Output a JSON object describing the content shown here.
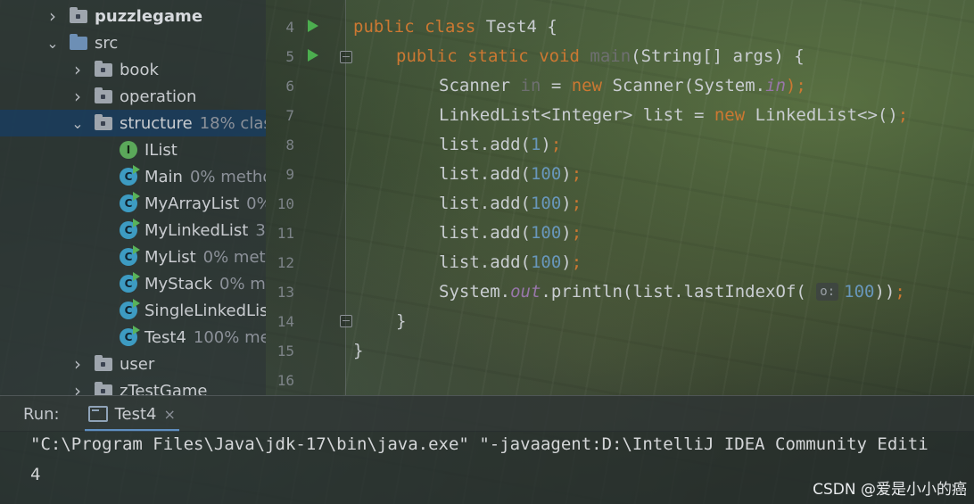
{
  "project_tree": [
    {
      "label": "puzzlegame",
      "coverage": "",
      "icon": "folder-icon",
      "expanded": false,
      "bold": true
    },
    {
      "label": "src",
      "coverage": "",
      "icon": "source-folder-icon",
      "expanded": true,
      "bold": false
    },
    {
      "label": "book",
      "coverage": "",
      "icon": "package-icon",
      "expanded": false
    },
    {
      "label": "operation",
      "coverage": "",
      "icon": "package-icon",
      "expanded": false
    },
    {
      "label": "structure",
      "coverage": "18% clas",
      "icon": "package-icon",
      "expanded": true,
      "selected": true
    },
    {
      "label": "IList",
      "coverage": "",
      "icon": "interface-icon"
    },
    {
      "label": "Main",
      "coverage": "0% metho",
      "icon": "class-run-icon"
    },
    {
      "label": "MyArrayList",
      "coverage": "0%",
      "icon": "class-run-icon"
    },
    {
      "label": "MyLinkedList",
      "coverage": "3",
      "icon": "class-run-icon"
    },
    {
      "label": "MyList",
      "coverage": "0% meth",
      "icon": "class-run-icon"
    },
    {
      "label": "MyStack",
      "coverage": "0% m",
      "icon": "class-run-icon"
    },
    {
      "label": "SingleLinkedList",
      "coverage": "",
      "icon": "class-run-icon"
    },
    {
      "label": "Test4",
      "coverage": "100% me",
      "icon": "class-run-icon"
    },
    {
      "label": "user",
      "coverage": "",
      "icon": "package-icon",
      "expanded": false
    },
    {
      "label": "zTestGame",
      "coverage": "",
      "icon": "package-icon",
      "expanded": false
    }
  ],
  "editor": {
    "line_numbers": [
      "4",
      "5",
      "6",
      "7",
      "8",
      "9",
      "10",
      "11",
      "12",
      "13",
      "14",
      "15",
      "16"
    ],
    "lines": {
      "l4": {
        "kw1": "public",
        "kw2": "class",
        "rest": " Test4 {"
      },
      "l5": {
        "kw1": "public",
        "kw2": "static",
        "kw3": "void",
        "name": "main",
        "rest": "(String[] args) {"
      },
      "l6": {
        "a": "Scanner ",
        "b": "in",
        "c": " = ",
        "d": "new",
        "e": " Scanner(System.",
        "f": "in",
        "g": ");"
      },
      "l7": {
        "a": "LinkedList<Integer> list = ",
        "b": "new",
        "c": " LinkedList<>()",
        "d": ";"
      },
      "l8": {
        "a": "list.add(",
        "n": "1",
        "b": ")",
        "c": ";"
      },
      "l9": {
        "a": "list.add(",
        "n": "100",
        "b": ")",
        "c": ";"
      },
      "l10": {
        "a": "list.add(",
        "n": "100",
        "b": ")",
        "c": ";"
      },
      "l11": {
        "a": "list.add(",
        "n": "100",
        "b": ")",
        "c": ";"
      },
      "l12": {
        "a": "list.add(",
        "n": "100",
        "b": ")",
        "c": ";"
      },
      "l13": {
        "a": "System.",
        "f": "out",
        "b": ".println(list.lastIndexOf( ",
        "hint": "o:",
        "n": "100",
        "c": "))",
        "d": ";"
      },
      "l14": {
        "a": "}"
      },
      "l15": {
        "a": "}"
      }
    }
  },
  "run_panel": {
    "label": "Run:",
    "tab": "Test4",
    "tab_close": "×"
  },
  "console": {
    "line1": "\"C:\\Program Files\\Java\\jdk-17\\bin\\java.exe\" \"-javaagent:D:\\IntelliJ IDEA Community Editi",
    "line2": "4"
  },
  "watermark": "CSDN @爱是小小的癌"
}
